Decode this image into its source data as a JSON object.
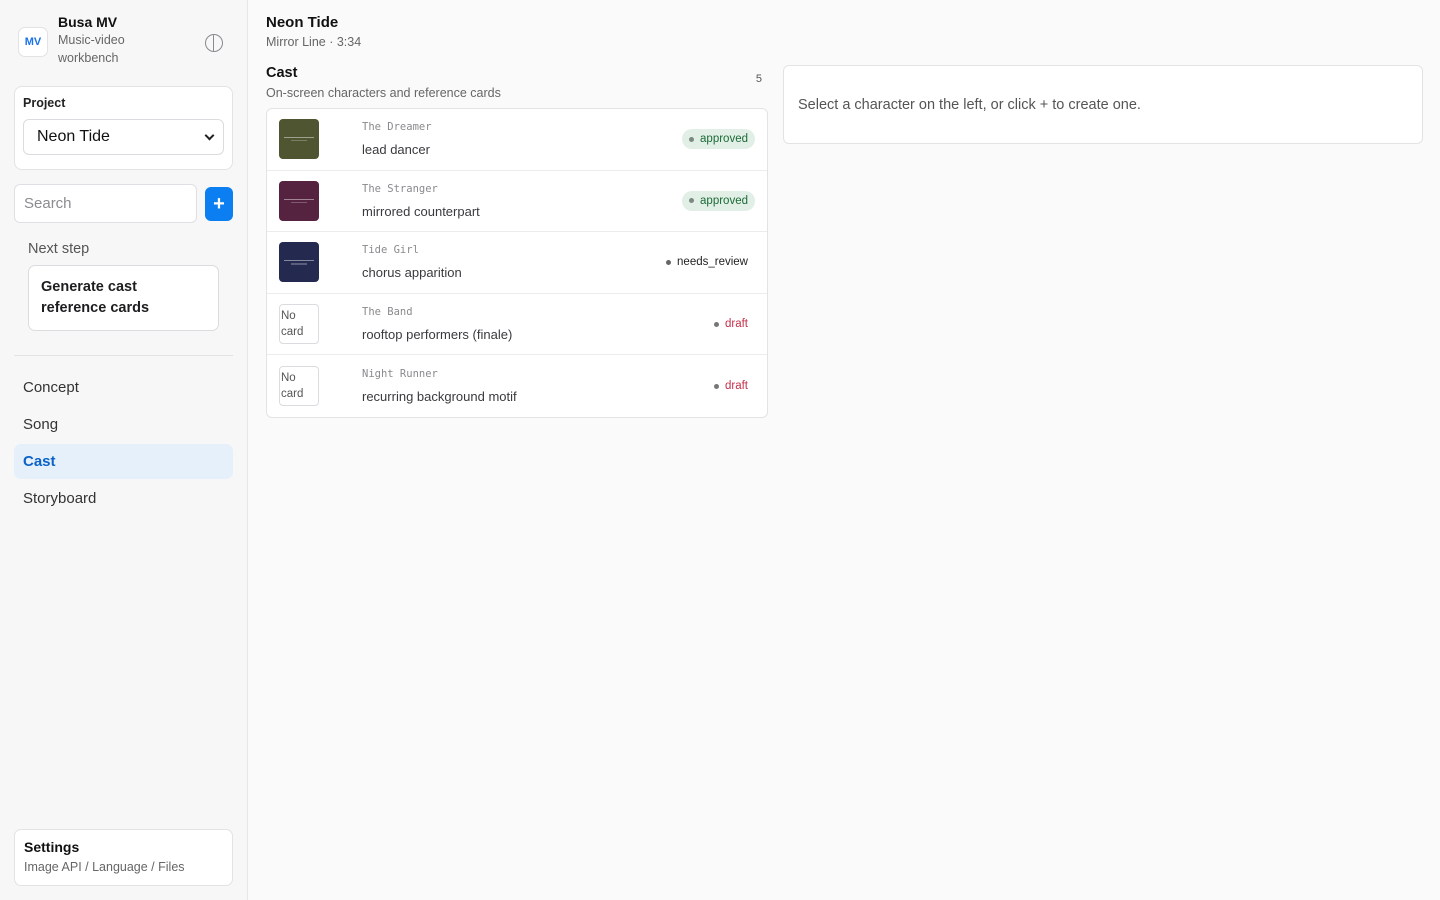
{
  "brand": {
    "logo": "MV",
    "title": "Busa MV",
    "subtitle": "Music-video workbench",
    "theme_toggle_icon": "half-circle-icon"
  },
  "project": {
    "label": "Project",
    "selected": "Neon Tide"
  },
  "search": {
    "placeholder": "Search",
    "value": "",
    "add_label": "+"
  },
  "next_step": {
    "label": "Next step",
    "action": "Generate cast reference cards"
  },
  "nav": {
    "items": [
      {
        "label": "Concept",
        "active": false
      },
      {
        "label": "Song",
        "active": false
      },
      {
        "label": "Cast",
        "active": true
      },
      {
        "label": "Storyboard",
        "active": false
      }
    ]
  },
  "settings": {
    "title": "Settings",
    "subtitle": "Image API / Language / Files"
  },
  "page": {
    "title": "Neon Tide",
    "subtitle": "Mirror Line · 3:34"
  },
  "cast": {
    "title": "Cast",
    "subtitle": "On-screen characters and reference cards",
    "count": "5",
    "rows": [
      {
        "name": "The Dreamer",
        "role": "lead dancer",
        "status": "approved",
        "thumb": "#4e5530",
        "no_card": ""
      },
      {
        "name": "The Stranger",
        "role": "mirrored counterpart",
        "status": "approved",
        "thumb": "#55223f",
        "no_card": ""
      },
      {
        "name": "Tide Girl",
        "role": "chorus apparition",
        "status": "needs_review",
        "thumb": "#23294f",
        "no_card": ""
      },
      {
        "name": "The Band",
        "role": "rooftop performers (finale)",
        "status": "draft",
        "thumb": "",
        "no_card": "No card"
      },
      {
        "name": "Night Runner",
        "role": "recurring background motif",
        "status": "draft",
        "thumb": "",
        "no_card": "No card"
      }
    ]
  },
  "detail": {
    "empty_message": "Select a character on the left, or click + to create one."
  },
  "colors": {
    "accent": "#0b7ef1",
    "nav_active_bg": "#e6f0fb",
    "nav_active_text": "#0b63c7",
    "approved_bg": "#e1efe6",
    "approved_text": "#1c6b37",
    "draft_text": "#c4314b"
  }
}
